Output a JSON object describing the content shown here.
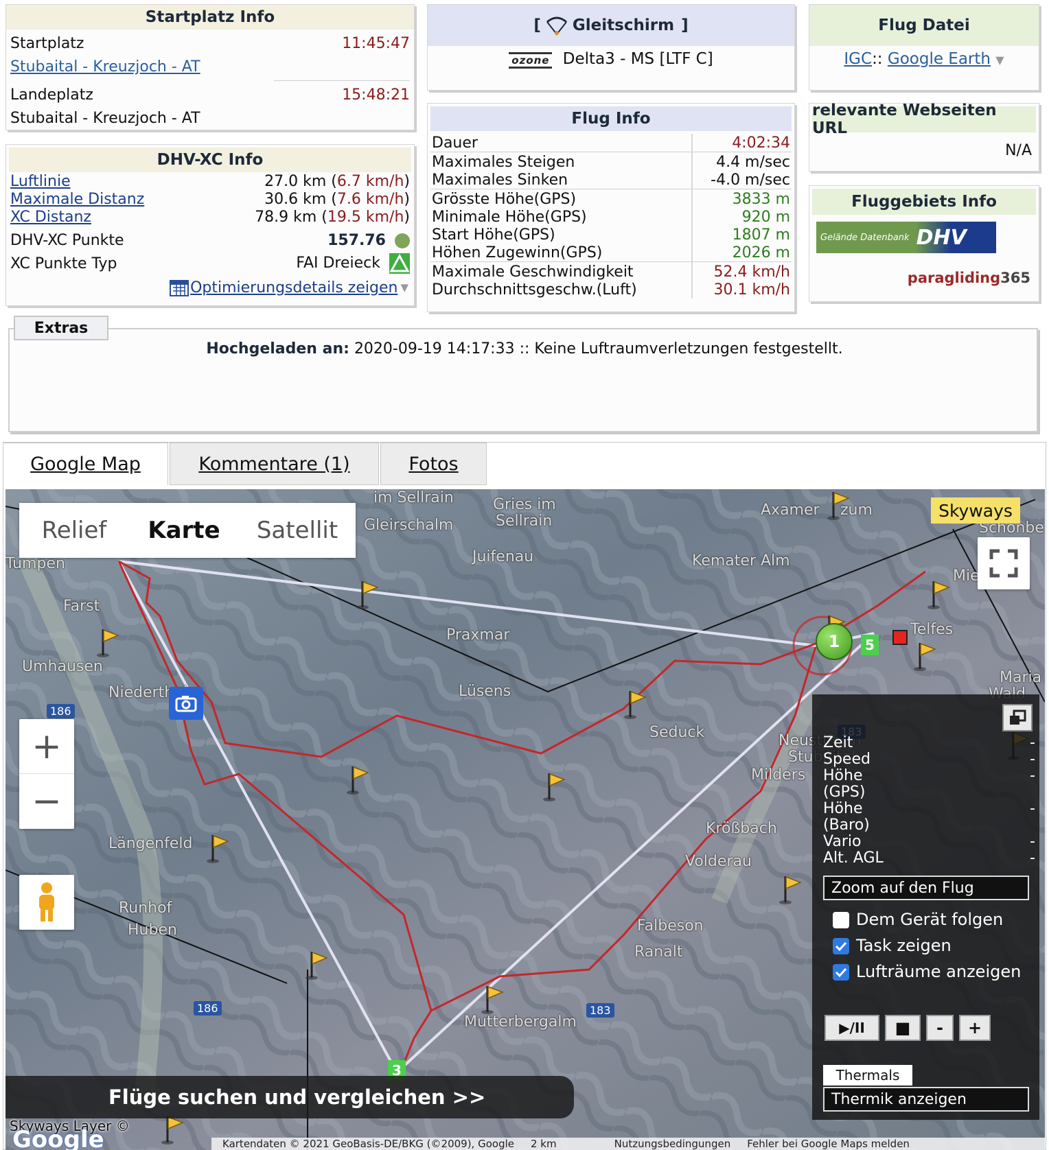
{
  "startplatz": {
    "title": "Startplatz Info",
    "start_label": "Startplatz",
    "start_time": "11:45:47",
    "start_site": "Stubaital - Kreuzjoch - AT",
    "landing_label": "Landeplatz",
    "landing_time": "15:48:21",
    "landing_site": "Stubaital - Kreuzjoch - AT"
  },
  "glider": {
    "title_prefix": "[",
    "title": "Gleitschirm",
    "title_suffix": "]",
    "brand": "ozone",
    "model": "Delta3 - MS [LTF C]"
  },
  "flugdatei": {
    "title": "Flug Datei",
    "igc": "IGC",
    "separator": "::",
    "google_earth": "Google Earth"
  },
  "dhvxc": {
    "title": "DHV-XC Info",
    "rows": [
      {
        "label": "Luftlinie",
        "km": "27.0 km",
        "speed": "6.7 km/h"
      },
      {
        "label": "Maximale Distanz",
        "km": "30.6 km",
        "speed": "7.6 km/h"
      },
      {
        "label": "XC Distanz",
        "km": "78.9 km",
        "speed": "19.5 km/h"
      }
    ],
    "points_label": "DHV-XC Punkte",
    "points": "157.76",
    "type_label": "XC Punkte Typ",
    "type": "FAI Dreieck",
    "optimize": "Optimierungsdetails zeigen"
  },
  "fluginfo": {
    "title": "Flug Info",
    "rows": [
      {
        "label": "Dauer",
        "value": "4:02:34"
      },
      {
        "label": "Maximales Steigen",
        "value": "4.4 m/sec"
      },
      {
        "label": "Maximales Sinken",
        "value": "-4.0 m/sec"
      },
      {
        "label": "Grösste Höhe(GPS)",
        "value": "3833 m"
      },
      {
        "label": "Minimale Höhe(GPS)",
        "value": "920 m"
      },
      {
        "label": "Start Höhe(GPS)",
        "value": "1807 m"
      },
      {
        "label": "Höhen Zugewinn(GPS)",
        "value": "2026 m"
      },
      {
        "label": "Maximale Geschwindigkeit",
        "value": "52.4 km/h"
      },
      {
        "label": "Durchschnittsgeschw.(Luft)",
        "value": "30.1 km/h"
      }
    ]
  },
  "webseiten": {
    "title": "relevante Webseiten URL",
    "value": "N/A"
  },
  "fluggebiet": {
    "title": "Fluggebiets Info",
    "dhv_text": "Gelände Datenbank",
    "dhv_logo": "DHV",
    "pg365_a": "paragliding",
    "pg365_b": "365"
  },
  "extras": {
    "tab": "Extras",
    "uploaded_label": "Hochgeladen an:",
    "uploaded_text": "2020-09-19 14:17:33 :: Keine Luftraumverletzungen festgestellt."
  },
  "tabs": [
    "Google Map",
    "Kommentare (1)",
    "Fotos"
  ],
  "map": {
    "types": [
      "Relief",
      "Karte",
      "Satellit"
    ],
    "skyways": "Skyways",
    "places": [
      "im Sellrain",
      "Gries im",
      "Sellrain",
      "Gleirschalm",
      "Juifenau",
      "Axamer",
      "zum",
      "Schönbe",
      "Tumpen",
      "Kemater Alm",
      "Farst",
      "Praxmar",
      "Umhausen",
      "Niederthai",
      "Lüsens",
      "Seduck",
      "Neustift im",
      "Stubaital",
      "Milders",
      "Längenfeld",
      "Krößbach",
      "Volderau",
      "Runhof",
      "Huben",
      "Falbeson",
      "Ranalt",
      "Mutterbergalm",
      "Mieders",
      "Telfes",
      "Maria",
      "Wald"
    ],
    "roads": [
      "186",
      "183",
      "186",
      "183",
      "183"
    ],
    "search_banner": "Flüge suchen und vergleichen >>",
    "layer_credit": "Skyways Layer ©",
    "google": "Google",
    "attribution": "Kartendaten © 2021 GeoBasis-DE/BKG (©2009), Google",
    "scale": "2 km",
    "terms": "Nutzungsbedingungen",
    "report": "Fehler bei Google Maps melden",
    "turnpoints": [
      "1",
      "3",
      "5"
    ]
  },
  "sidepanel": {
    "lines": [
      "Zeit",
      "Speed",
      "Höhe",
      "(GPS)",
      "Höhe",
      "(Baro)",
      "Vario",
      "Alt. AGL"
    ],
    "dash": "-",
    "zoom_flight": "Zoom auf den Flug",
    "follow": "Dem Gerät folgen",
    "task": "Task zeigen",
    "airspace": "Lufträume anzeigen",
    "play": "▶/II",
    "stop": "■",
    "minus": "-",
    "plus": "+",
    "thermals": "Thermals",
    "thermik": "Thermik anzeigen"
  },
  "colors": {
    "track": "#c4272a",
    "task": "#e6e6f5",
    "accent_blue": "#1b3f8a",
    "value_red": "#8a1c1c",
    "value_green": "#2e7d1e"
  }
}
